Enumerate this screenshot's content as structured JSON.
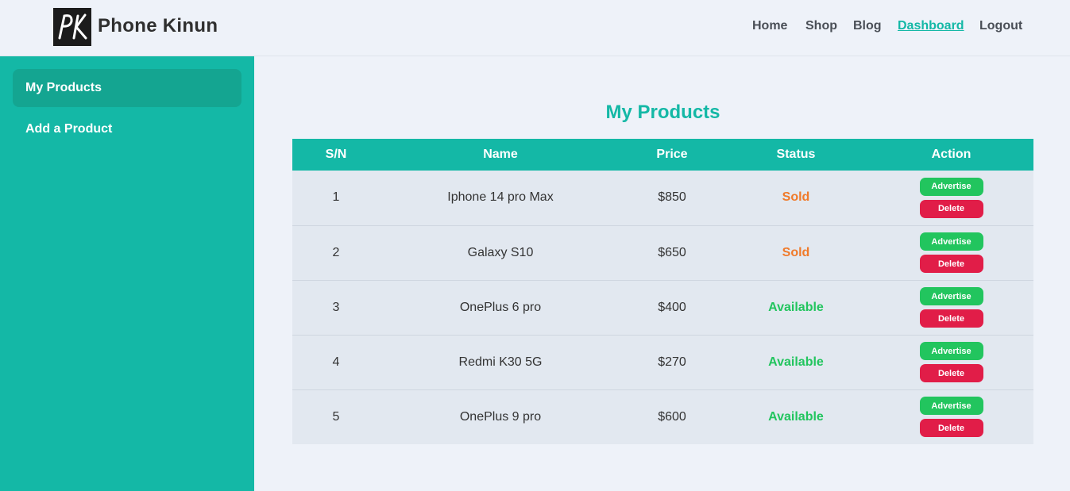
{
  "brand": {
    "name": "Phone Kinun",
    "logo_text": "PK"
  },
  "nav": {
    "items": [
      {
        "label": "Home",
        "active": false
      },
      {
        "label": "Shop",
        "active": false
      },
      {
        "label": "Blog",
        "active": false
      },
      {
        "label": "Dashboard",
        "active": true
      },
      {
        "label": "Logout",
        "active": false
      }
    ]
  },
  "sidebar": {
    "items": [
      {
        "label": "My Products",
        "active": true
      },
      {
        "label": "Add a Product",
        "active": false
      }
    ]
  },
  "main": {
    "title": "My Products",
    "table": {
      "columns": [
        "S/N",
        "Name",
        "Price",
        "Status",
        "Action"
      ],
      "rows": [
        {
          "sn": "1",
          "name": "Iphone 14 pro Max",
          "price": "$850",
          "status": "Sold"
        },
        {
          "sn": "2",
          "name": "Galaxy S10",
          "price": "$650",
          "status": "Sold"
        },
        {
          "sn": "3",
          "name": "OnePlus 6 pro",
          "price": "$400",
          "status": "Available"
        },
        {
          "sn": "4",
          "name": "Redmi K30 5G",
          "price": "$270",
          "status": "Available"
        },
        {
          "sn": "5",
          "name": "OnePlus 9 pro",
          "price": "$600",
          "status": "Available"
        }
      ],
      "advertise_label": "Advertise",
      "delete_label": "Delete"
    }
  },
  "colors": {
    "accent": "#14b8a6",
    "sold": "#f07a2a",
    "available": "#22c55e",
    "delete": "#e11d48"
  }
}
